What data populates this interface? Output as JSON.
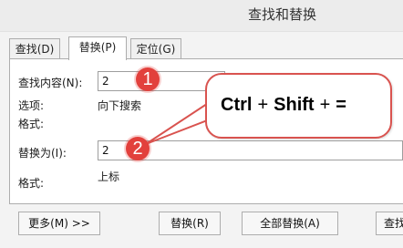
{
  "window": {
    "title": "查找和替换"
  },
  "tabs": [
    {
      "label": "查找(D)"
    },
    {
      "label": "替换(P)"
    },
    {
      "label": "定位(G)"
    }
  ],
  "find": {
    "label": "查找内容(N):",
    "value": "2",
    "options_label": "选项:",
    "options_value": "向下搜索",
    "format_label": "格式:"
  },
  "replace": {
    "label": "替换为(I):",
    "value": "2",
    "format_label": "格式:",
    "format_value": "上标"
  },
  "annotation": {
    "badge_1": "1",
    "badge_2": "2",
    "key_1": "Ctrl",
    "plus_1": "+",
    "key_2": "Shift",
    "plus_2": "+",
    "key_3": "="
  },
  "buttons": {
    "more": "更多(M) >>",
    "replace": "替换(R)",
    "replace_all": "全部替换(A)",
    "find_next": "查找"
  },
  "colors": {
    "accent_red": "#e2403c"
  }
}
